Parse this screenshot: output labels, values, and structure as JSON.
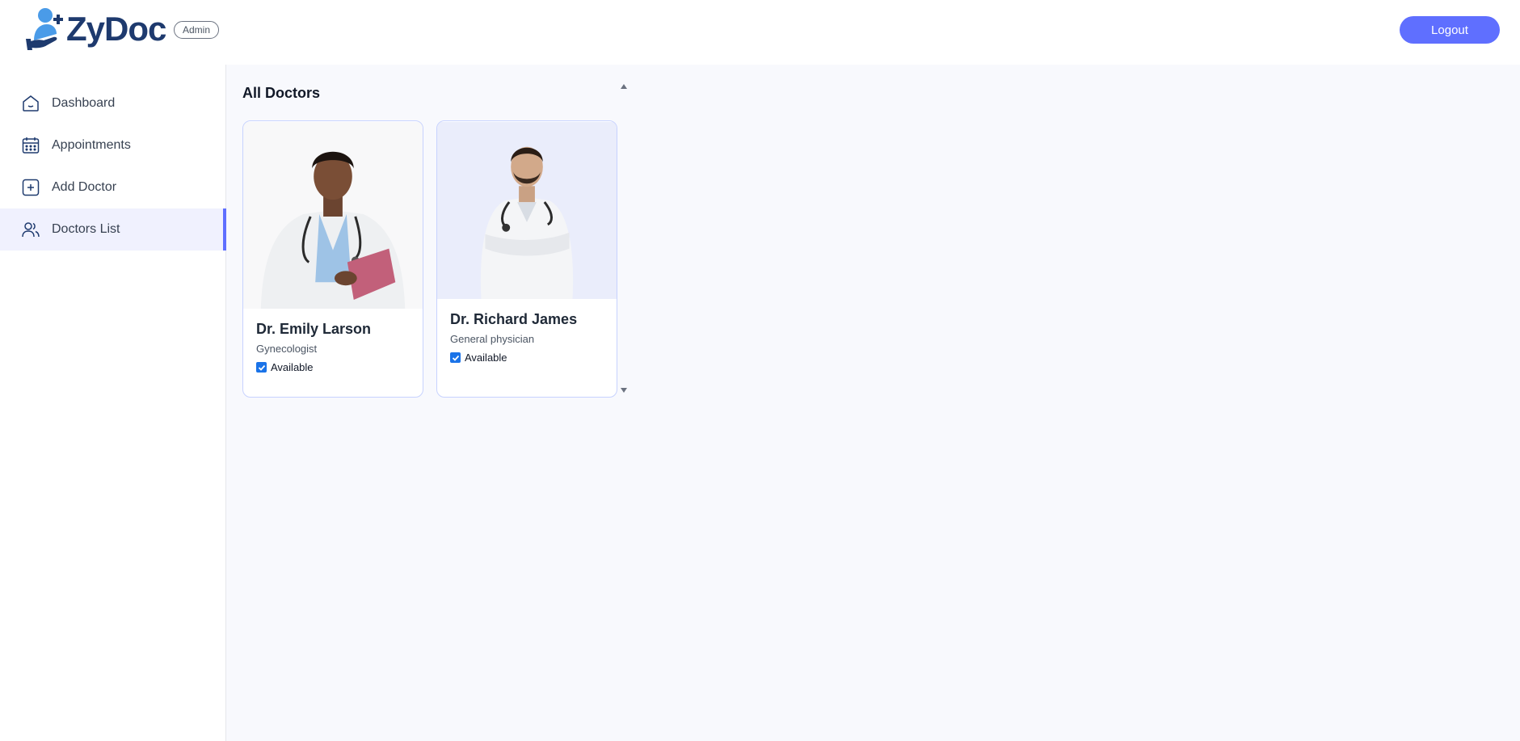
{
  "header": {
    "logo_text": "ZyDoc",
    "role_badge": "Admin",
    "logout_label": "Logout"
  },
  "sidebar": {
    "items": [
      {
        "label": "Dashboard",
        "icon": "home-icon",
        "active": false
      },
      {
        "label": "Appointments",
        "icon": "calendar-icon",
        "active": false
      },
      {
        "label": "Add Doctor",
        "icon": "add-icon",
        "active": false
      },
      {
        "label": "Doctors List",
        "icon": "people-icon",
        "active": true
      }
    ]
  },
  "main": {
    "title": "All Doctors",
    "doctors": [
      {
        "name": "Dr. Emily Larson",
        "speciality": "Gynecologist",
        "available_label": "Available",
        "available": true
      },
      {
        "name": "Dr. Richard James",
        "speciality": "General physician",
        "available_label": "Available",
        "available": true
      }
    ]
  },
  "colors": {
    "accent": "#5f6fff",
    "logo_dark": "#1e3a6e",
    "logo_light": "#4a9be8",
    "card_border": "#c7d2fe",
    "main_bg": "#f8f9fd",
    "active_bg": "#f0f1fe"
  }
}
